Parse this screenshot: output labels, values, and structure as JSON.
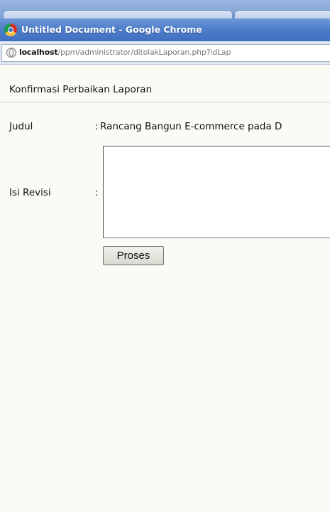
{
  "window": {
    "title": "Untitled Document - Google Chrome",
    "url_host": "localhost",
    "url_path": "/ppm/administrator/ditolakLaporan.php?idLap"
  },
  "page": {
    "heading": "Konfirmasi Perbaikan Laporan",
    "judul_label": "Judul",
    "judul_colon": ":",
    "judul_value": "Rancang Bangun E-commerce pada D",
    "isi_revisi_label": "Isi Revisi",
    "isi_revisi_colon": ":",
    "isi_revisi_value": "",
    "submit_label": "Proses"
  }
}
